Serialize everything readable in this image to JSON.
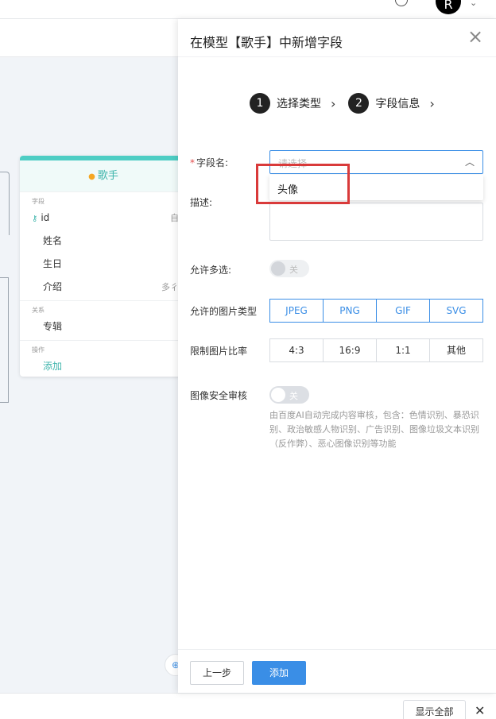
{
  "topbar": {
    "avatar_letter": "R",
    "caret": "⌄"
  },
  "model_card": {
    "title": "歌手",
    "fields_section": "字段",
    "fields": [
      {
        "label": "id",
        "right": "自"
      },
      {
        "label": "姓名",
        "right": ""
      },
      {
        "label": "生日",
        "right": ""
      },
      {
        "label": "介绍",
        "right": "多彳"
      }
    ],
    "relations_section": "关系",
    "relations": [
      {
        "label": "专辑"
      }
    ],
    "actions_section": "操作",
    "add_label": "添加"
  },
  "drawer": {
    "title": "在模型【歌手】中新增字段",
    "close": "×",
    "steps": [
      {
        "num": "1",
        "label": "选择类型"
      },
      {
        "num": "2",
        "label": "字段信息"
      }
    ],
    "field_name": {
      "label": "字段名:",
      "required_mark": "*",
      "placeholder": "请选择",
      "options": [
        "头像"
      ]
    },
    "description_label": "描述:",
    "allow_multiple": {
      "label": "允许多选:",
      "toggle_text": "关"
    },
    "image_types": {
      "label": "允许的图片类型",
      "options": [
        "JPEG",
        "PNG",
        "GIF",
        "SVG"
      ]
    },
    "image_ratio": {
      "label": "限制图片比率",
      "options": [
        "4:3",
        "16:9",
        "1:1",
        "其他"
      ]
    },
    "image_audit": {
      "label": "图像安全审核",
      "toggle_text": "关",
      "description": "由百度AI自动完成内容审核，包含：色情识别、暴恐识别、政治敏感人物识别、广告识别、图像垃圾文本识别（反作弊）、恶心图像识别等功能"
    },
    "prev_button": "上一步",
    "add_button": "添加"
  },
  "bottombar": {
    "show_all": "显示全部",
    "close": "✕"
  },
  "colors": {
    "accent": "#3a8ee6",
    "teal": "#3fb5ac",
    "highlight": "#d93a3a"
  }
}
